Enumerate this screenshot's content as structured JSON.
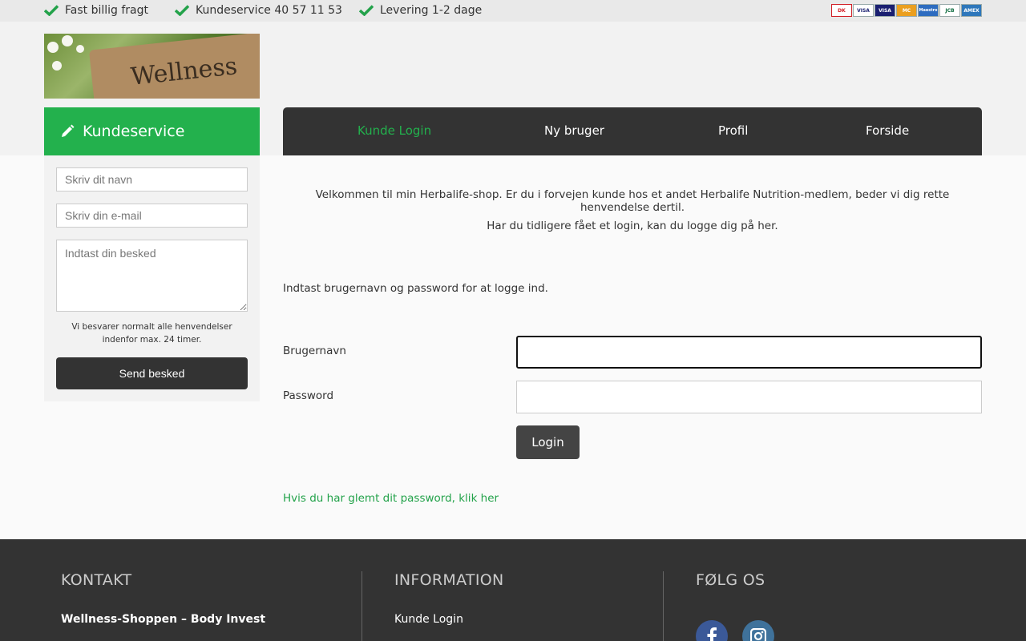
{
  "topbar": {
    "usps": [
      "Fast billig fragt",
      "Kundeservice 40 57 11 53",
      "Levering 1-2 dage"
    ],
    "payment_icons": [
      "dankort-icon",
      "visa-icon",
      "visa-electron-icon",
      "mastercard-icon",
      "maestro-icon",
      "jcb-icon",
      "amex-icon"
    ],
    "payment_labels": [
      "DK",
      "VISA",
      "VISA",
      "MC",
      "Maestro",
      "JCB",
      "AMEX"
    ]
  },
  "logo": {
    "text": "Wellness"
  },
  "sidebar": {
    "title": "Kundeservice",
    "name_placeholder": "Skriv dit navn",
    "email_placeholder": "Skriv din e-mail",
    "message_placeholder": "Indtast din besked",
    "note": "Vi besvarer normalt alle henvendelser indenfor max. 24 timer.",
    "send_label": "Send besked"
  },
  "nav": {
    "items": [
      "Kunde Login",
      "Ny bruger",
      "Profil",
      "Forside"
    ],
    "active_index": 0
  },
  "main": {
    "welcome": "Velkommen til min Herbalife-shop. Er du i forvejen kunde hos et andet Herbalife Nutrition-medlem, beder vi dig rette henvendelse dertil.",
    "login_hint": "Har du tidligere fået et login, kan du logge dig på her.",
    "instruction": "Indtast brugernavn og password for at logge ind.",
    "username_label": "Brugernavn",
    "password_label": "Password",
    "username_value": "",
    "password_value": "",
    "login_label": "Login",
    "forgot_link": "Hvis du har glemt dit password, klik her"
  },
  "footer": {
    "kontakt_title": "KONTAKT",
    "kontakt_company": "Wellness-Shoppen – Body Invest",
    "information_title": "INFORMATION",
    "information_link": "Kunde Login",
    "follow_title": "FØLG OS",
    "social_icons": [
      "facebook-icon",
      "instagram-icon"
    ]
  },
  "colors": {
    "accent_green": "#23b14d",
    "dark": "#333333",
    "facebook": "#3b5998",
    "instagram": "#3f729b"
  }
}
